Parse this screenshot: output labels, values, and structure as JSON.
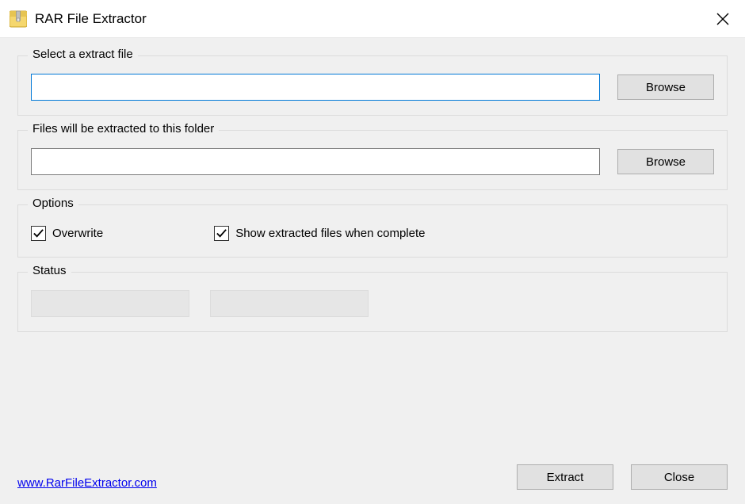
{
  "window": {
    "title": "RAR File Extractor",
    "close_aria": "Close"
  },
  "groups": {
    "select_file": {
      "title": "Select a extract file",
      "input_value": "",
      "browse_label": "Browse"
    },
    "dest_folder": {
      "title": "Files will be extracted to this folder",
      "input_value": "",
      "browse_label": "Browse"
    },
    "options": {
      "title": "Options",
      "overwrite": {
        "label": "Overwrite",
        "checked": true
      },
      "show_extracted": {
        "label": "Show extracted files when complete",
        "checked": true
      }
    },
    "status": {
      "title": "Status"
    }
  },
  "footer": {
    "link_text": "www.RarFileExtractor.com",
    "extract_label": "Extract",
    "close_label": "Close"
  }
}
